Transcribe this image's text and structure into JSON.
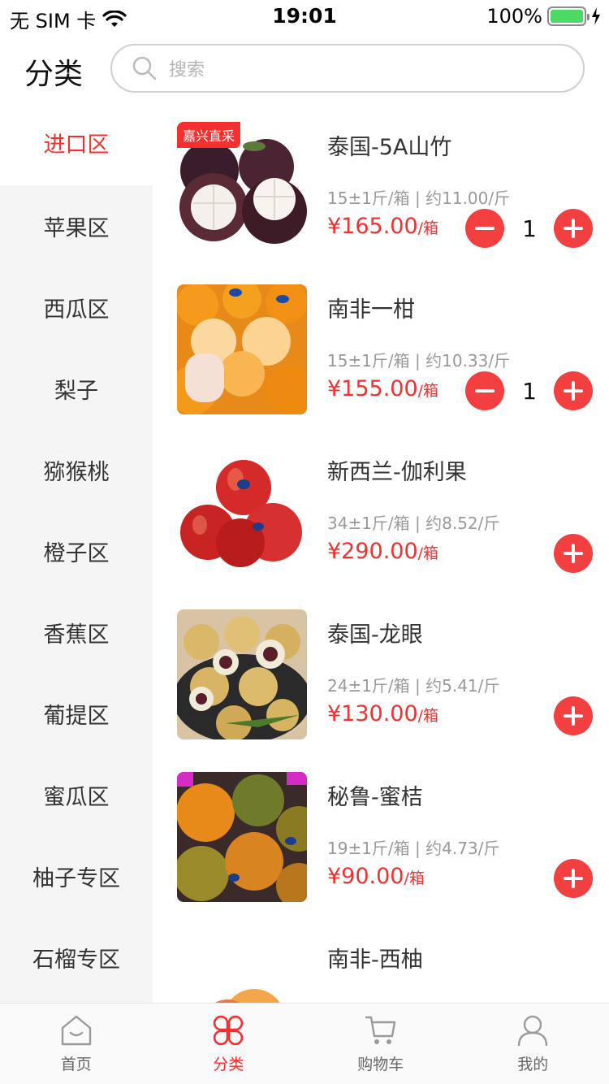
{
  "status_bar": {
    "carrier": "无 SIM 卡",
    "time": "19:01",
    "battery": "100%"
  },
  "header": {
    "title": "分类",
    "search_placeholder": "搜索"
  },
  "sidebar": {
    "items": [
      {
        "label": "进口区",
        "active": true
      },
      {
        "label": "苹果区"
      },
      {
        "label": "西瓜区"
      },
      {
        "label": "梨子"
      },
      {
        "label": "猕猴桃"
      },
      {
        "label": "橙子区"
      },
      {
        "label": "香蕉区"
      },
      {
        "label": "葡提区"
      },
      {
        "label": "蜜瓜区"
      },
      {
        "label": "柚子专区"
      },
      {
        "label": "石榴专区"
      }
    ]
  },
  "products": [
    {
      "title": "泰国-5A山竹",
      "tag": "嘉兴直采",
      "spec": "15±1斤/箱 | 约11.00/斤",
      "price": "¥165.00",
      "unit": "/箱",
      "qty": "1"
    },
    {
      "title": "南非一柑",
      "spec": "15±1斤/箱 | 约10.33/斤",
      "price": "¥155.00",
      "unit": "/箱",
      "qty": "1"
    },
    {
      "title": "新西兰-伽利果",
      "spec": "34±1斤/箱 | 约8.52/斤",
      "price": "¥290.00",
      "unit": "/箱"
    },
    {
      "title": "泰国-龙眼",
      "spec": "24±1斤/箱 | 约5.41/斤",
      "price": "¥130.00",
      "unit": "/箱"
    },
    {
      "title": "秘鲁-蜜桔",
      "spec": "19±1斤/箱 | 约4.73/斤",
      "price": "¥90.00",
      "unit": "/箱"
    },
    {
      "title": "南非-西柚"
    }
  ],
  "tabbar": {
    "tabs": [
      {
        "label": "首页",
        "icon": "home-icon"
      },
      {
        "label": "分类",
        "icon": "category-icon",
        "active": true
      },
      {
        "label": "购物车",
        "icon": "cart-icon"
      },
      {
        "label": "我的",
        "icon": "user-icon"
      }
    ]
  },
  "colors": {
    "accent": "#f23030",
    "button": "#f33f3f",
    "sidebar_bg": "#f5f5f5"
  }
}
